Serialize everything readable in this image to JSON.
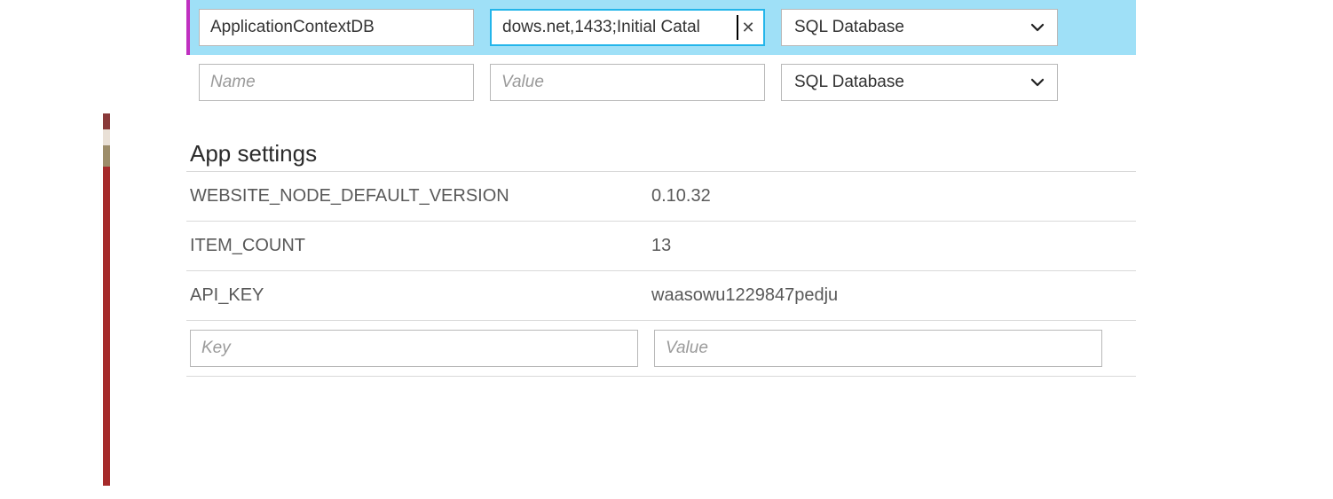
{
  "connection_strings": {
    "rows": [
      {
        "name_value": "ApplicationContextDB",
        "name_placeholder": "Name",
        "value_value": "dows.net,1433;Initial Catal",
        "value_placeholder": "Value",
        "type_label": "SQL Database",
        "active": true
      },
      {
        "name_value": "",
        "name_placeholder": "Name",
        "value_value": "",
        "value_placeholder": "Value",
        "type_label": "SQL Database",
        "active": false
      }
    ]
  },
  "app_settings": {
    "heading": "App settings",
    "items": [
      {
        "key": "WEBSITE_NODE_DEFAULT_VERSION",
        "value": "0.10.32"
      },
      {
        "key": "ITEM_COUNT",
        "value": "13"
      },
      {
        "key": "API_KEY",
        "value": "waasowu1229847pedju"
      }
    ],
    "new_key_placeholder": "Key",
    "new_value_placeholder": "Value"
  }
}
